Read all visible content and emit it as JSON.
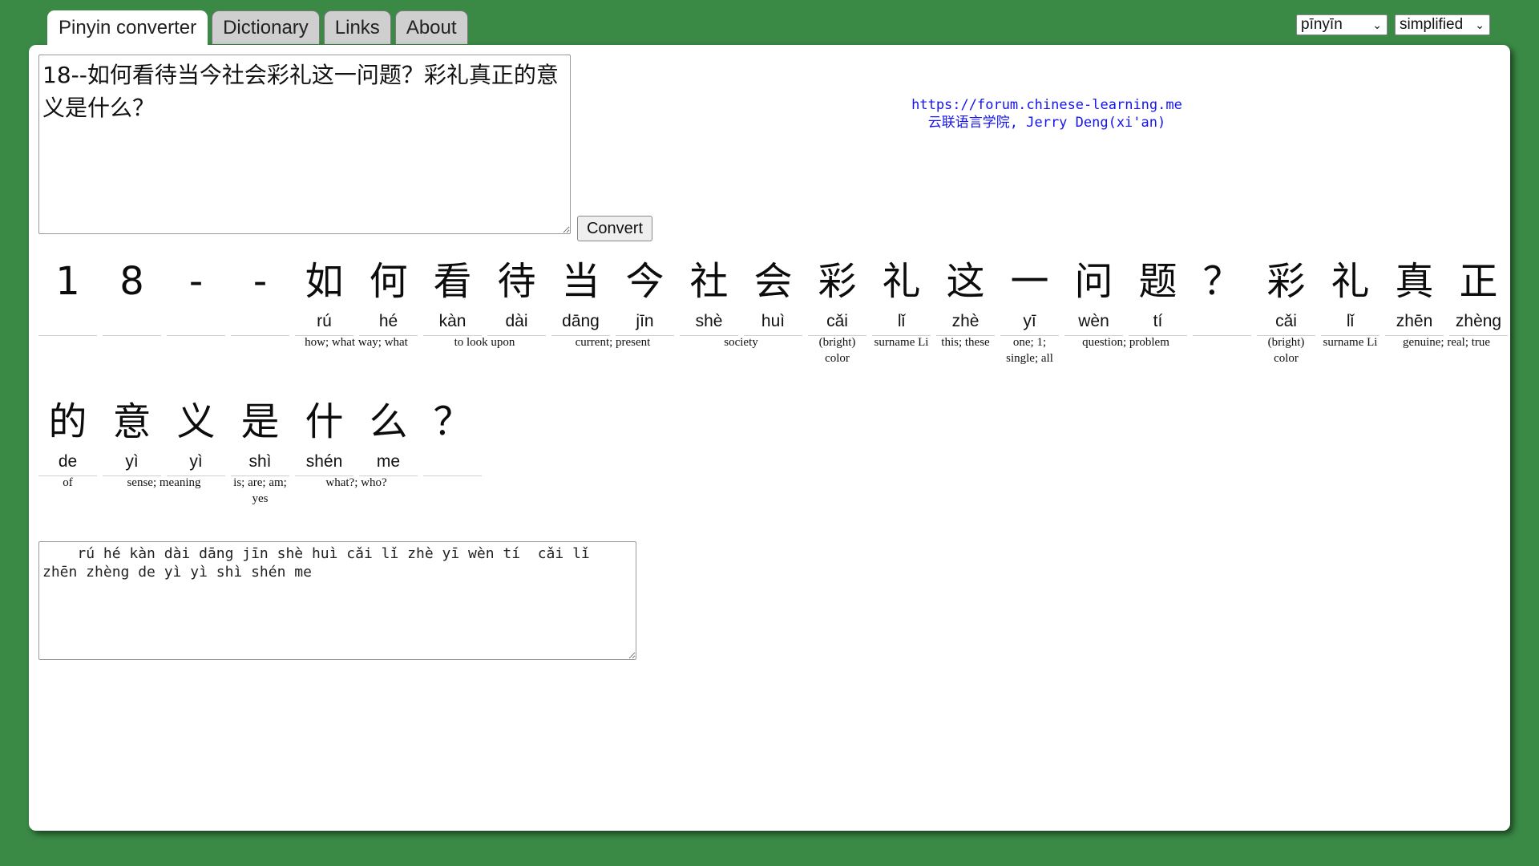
{
  "tabs": [
    {
      "label": "Pinyin converter",
      "active": true
    },
    {
      "label": "Dictionary",
      "active": false
    },
    {
      "label": "Links",
      "active": false
    },
    {
      "label": "About",
      "active": false
    }
  ],
  "selects": {
    "romanization": "pīnyīn",
    "script": "simplified"
  },
  "input_text": "18--如何看待当今社会彩礼这一问题？彩礼真正的意义是什么？",
  "convert_label": "Convert",
  "credit": {
    "url": "https://forum.chinese-learning.me",
    "author": "云联语言学院, Jerry Deng(xi'an)"
  },
  "rows": [
    [
      {
        "hz": "1",
        "py": ""
      },
      {
        "hz": "8",
        "py": ""
      },
      {
        "hz": "-",
        "py": ""
      },
      {
        "hz": "-",
        "py": ""
      },
      {
        "hz": "如",
        "py": "rú"
      },
      {
        "hz": "何",
        "py": "hé"
      },
      {
        "hz": "看",
        "py": "kàn"
      },
      {
        "hz": "待",
        "py": "dài"
      },
      {
        "hz": "当",
        "py": "dāng"
      },
      {
        "hz": "今",
        "py": "jīn"
      },
      {
        "hz": "社",
        "py": "shè"
      },
      {
        "hz": "会",
        "py": "huì"
      },
      {
        "hz": "彩",
        "py": "cǎi"
      },
      {
        "hz": "礼",
        "py": "lǐ"
      },
      {
        "hz": "这",
        "py": "zhè"
      },
      {
        "hz": "一",
        "py": "yī"
      },
      {
        "hz": "问",
        "py": "wèn"
      },
      {
        "hz": "题",
        "py": "tí"
      },
      {
        "hz": "？",
        "py": ""
      },
      {
        "hz": "彩",
        "py": "cǎi"
      },
      {
        "hz": "礼",
        "py": "lǐ"
      },
      {
        "hz": "真",
        "py": "zhēn"
      },
      {
        "hz": "正",
        "py": "zhèng"
      }
    ],
    [
      {
        "hz": "的",
        "py": "de"
      },
      {
        "hz": "意",
        "py": "yì"
      },
      {
        "hz": "义",
        "py": "yì"
      },
      {
        "hz": "是",
        "py": "shì"
      },
      {
        "hz": "什",
        "py": "shén"
      },
      {
        "hz": "么",
        "py": "me"
      },
      {
        "hz": "？",
        "py": ""
      }
    ]
  ],
  "definitions": [
    [
      {
        "start": 4,
        "span": 2,
        "text": "how; what way; what"
      },
      {
        "start": 6,
        "span": 2,
        "text": "to look upon"
      },
      {
        "start": 8,
        "span": 2,
        "text": "current; present"
      },
      {
        "start": 10,
        "span": 2,
        "text": "society"
      },
      {
        "start": 12,
        "span": 1,
        "text": "(bright) color"
      },
      {
        "start": 13,
        "span": 1,
        "text": "surname Li"
      },
      {
        "start": 14,
        "span": 1,
        "text": "this; these"
      },
      {
        "start": 15,
        "span": 1,
        "text": "one; 1; single; all"
      },
      {
        "start": 16,
        "span": 2,
        "text": "question; problem"
      },
      {
        "start": 19,
        "span": 1,
        "text": "(bright) color"
      },
      {
        "start": 20,
        "span": 1,
        "text": "surname Li"
      },
      {
        "start": 21,
        "span": 2,
        "text": "genuine; real; true"
      }
    ],
    [
      {
        "start": 0,
        "span": 1,
        "text": "of"
      },
      {
        "start": 1,
        "span": 2,
        "text": "sense; meaning"
      },
      {
        "start": 3,
        "span": 1,
        "text": "is; are; am; yes"
      },
      {
        "start": 4,
        "span": 2,
        "text": "what?; who?"
      }
    ]
  ],
  "output_text": "    rú hé kàn dài dāng jīn shè huì cǎi lǐ zhè yī wèn tí  cǎi lǐ zhēn zhèng de yì yì shì shén me"
}
